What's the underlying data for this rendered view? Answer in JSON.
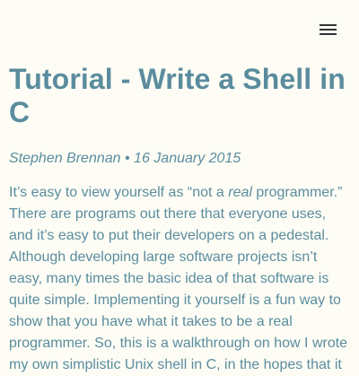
{
  "header": {
    "menu_icon": "hamburger-menu-icon"
  },
  "post": {
    "title": "Tutorial - Write a Shell in C",
    "author": "Stephen Brennan",
    "separator": " • ",
    "date": "16 January 2015",
    "paragraph": {
      "part1": "It’s easy to view yourself as “not a ",
      "emph": "real",
      "part2": " programmer.” There are programs out there that everyone uses, and it’s easy to put their developers on a pedestal. Although developing large software projects isn’t easy, many times the basic idea of that software is quite simple. Implementing it yourself is a fun way to show that you have what it takes to be a real programmer. So, this is a walkthrough on how I wrote my own simplistic Unix shell in C, in the hopes that it"
    }
  },
  "colors": {
    "background": "#fdfdf5",
    "text": "#5b8c9e",
    "icon": "#333333"
  }
}
